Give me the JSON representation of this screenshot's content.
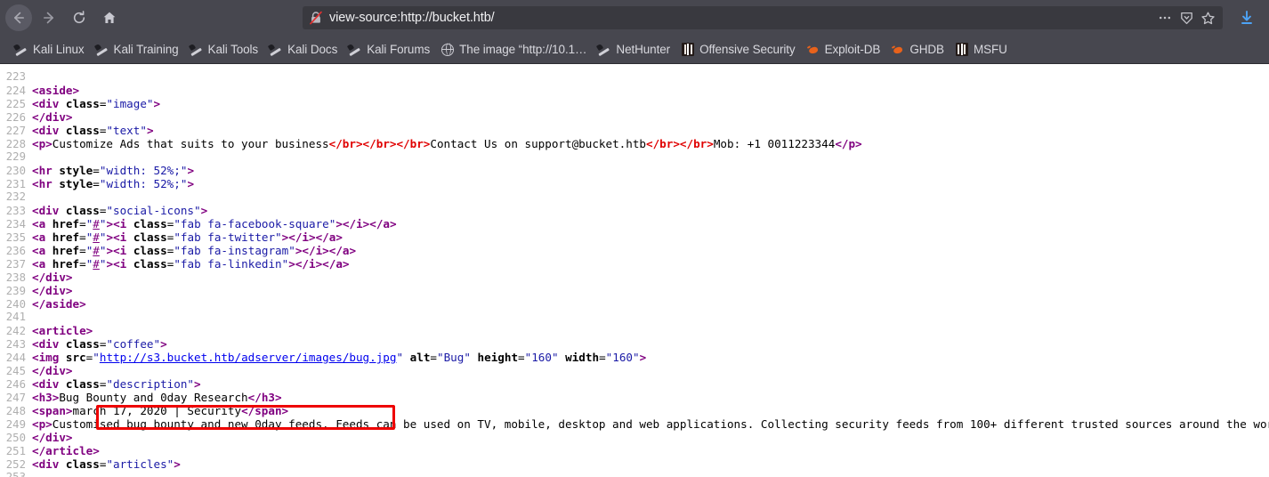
{
  "browser": {
    "nav": {
      "back_label": "Back",
      "forward_label": "Forward",
      "reload_label": "Reload",
      "home_label": "Home"
    },
    "url": "view-source:http://bucket.htb/",
    "url_security_icon": "insecure-padlock-crossed-icon",
    "page_actions_label": "…",
    "reader_label": "Reader view",
    "bookmark_star_label": "Bookmark this page",
    "downloads_label": "Downloads"
  },
  "bookmarks": [
    {
      "label": "Kali Linux",
      "icon": "kali-dragon-icon"
    },
    {
      "label": "Kali Training",
      "icon": "kali-dragon-icon"
    },
    {
      "label": "Kali Tools",
      "icon": "kali-dragon-icon"
    },
    {
      "label": "Kali Docs",
      "icon": "kali-dragon-icon"
    },
    {
      "label": "Kali Forums",
      "icon": "kali-dragon-icon"
    },
    {
      "label": "The image “http://10.1…",
      "icon": "globe-icon"
    },
    {
      "label": "NetHunter",
      "icon": "kali-dragon-icon"
    },
    {
      "label": "Offensive Security",
      "icon": "offensive-security-icon"
    },
    {
      "label": "Exploit-DB",
      "icon": "exploit-db-bug-icon"
    },
    {
      "label": "GHDB",
      "icon": "exploit-db-bug-icon"
    },
    {
      "label": "MSFU",
      "icon": "offensive-security-icon"
    }
  ],
  "source": {
    "first_line": 223,
    "highlight": {
      "color": "#ee0000",
      "target_line": 244,
      "target_text": "http://s3.bucket.htb/adserver/images/bug.jpg"
    },
    "lines": [
      {
        "n": 223,
        "tokens": []
      },
      {
        "n": 224,
        "tokens": [
          {
            "t": "tag",
            "v": "<aside>"
          }
        ]
      },
      {
        "n": 225,
        "tokens": [
          {
            "t": "tag",
            "v": "<div "
          },
          {
            "t": "attn",
            "v": "class"
          },
          {
            "t": "txt",
            "v": "="
          },
          {
            "t": "atv",
            "v": "\"image\""
          },
          {
            "t": "tag",
            "v": ">"
          }
        ]
      },
      {
        "n": 226,
        "tokens": [
          {
            "t": "tag",
            "v": "</div>"
          }
        ]
      },
      {
        "n": 227,
        "tokens": [
          {
            "t": "tag",
            "v": "<div "
          },
          {
            "t": "attn",
            "v": "class"
          },
          {
            "t": "txt",
            "v": "="
          },
          {
            "t": "atv",
            "v": "\"text\""
          },
          {
            "t": "tag",
            "v": ">"
          }
        ]
      },
      {
        "n": 228,
        "tokens": [
          {
            "t": "tag",
            "v": "<p>"
          },
          {
            "t": "txt",
            "v": "Customize Ads that suits to your business"
          },
          {
            "t": "brk",
            "v": "</br></br></br>"
          },
          {
            "t": "txt",
            "v": "Contact Us on support@bucket.htb"
          },
          {
            "t": "brk",
            "v": "</br></br>"
          },
          {
            "t": "txt",
            "v": "Mob: +1 0011223344"
          },
          {
            "t": "tag",
            "v": "</p>"
          }
        ]
      },
      {
        "n": 229,
        "tokens": []
      },
      {
        "n": 230,
        "tokens": [
          {
            "t": "tag",
            "v": "<hr "
          },
          {
            "t": "attn",
            "v": "style"
          },
          {
            "t": "txt",
            "v": "="
          },
          {
            "t": "atv",
            "v": "\"width: 52%;\""
          },
          {
            "t": "tag",
            "v": ">"
          }
        ]
      },
      {
        "n": 231,
        "tokens": [
          {
            "t": "tag",
            "v": "<hr "
          },
          {
            "t": "attn",
            "v": "style"
          },
          {
            "t": "txt",
            "v": "="
          },
          {
            "t": "atv",
            "v": "\"width: 52%;\""
          },
          {
            "t": "tag",
            "v": ">"
          }
        ]
      },
      {
        "n": 232,
        "tokens": []
      },
      {
        "n": 233,
        "tokens": [
          {
            "t": "tag",
            "v": "<div "
          },
          {
            "t": "attn",
            "v": "class"
          },
          {
            "t": "txt",
            "v": "="
          },
          {
            "t": "atv",
            "v": "\"social-icons\""
          },
          {
            "t": "tag",
            "v": ">"
          }
        ]
      },
      {
        "n": 234,
        "tokens": [
          {
            "t": "tag",
            "v": "<a "
          },
          {
            "t": "attn",
            "v": "href"
          },
          {
            "t": "txt",
            "v": "="
          },
          {
            "t": "atv",
            "v": "\""
          },
          {
            "t": "lnkv",
            "v": "#"
          },
          {
            "t": "atv",
            "v": "\""
          },
          {
            "t": "tag",
            "v": ">"
          },
          {
            "t": "tag",
            "v": "<i "
          },
          {
            "t": "attn",
            "v": "class"
          },
          {
            "t": "txt",
            "v": "="
          },
          {
            "t": "atv",
            "v": "\"fab fa-facebook-square\""
          },
          {
            "t": "tag",
            "v": ">"
          },
          {
            "t": "tag",
            "v": "</i>"
          },
          {
            "t": "tag",
            "v": "</a>"
          }
        ]
      },
      {
        "n": 235,
        "tokens": [
          {
            "t": "tag",
            "v": "<a "
          },
          {
            "t": "attn",
            "v": "href"
          },
          {
            "t": "txt",
            "v": "="
          },
          {
            "t": "atv",
            "v": "\""
          },
          {
            "t": "lnkv",
            "v": "#"
          },
          {
            "t": "atv",
            "v": "\""
          },
          {
            "t": "tag",
            "v": ">"
          },
          {
            "t": "tag",
            "v": "<i "
          },
          {
            "t": "attn",
            "v": "class"
          },
          {
            "t": "txt",
            "v": "="
          },
          {
            "t": "atv",
            "v": "\"fab fa-twitter\""
          },
          {
            "t": "tag",
            "v": ">"
          },
          {
            "t": "tag",
            "v": "</i>"
          },
          {
            "t": "tag",
            "v": "</a>"
          }
        ]
      },
      {
        "n": 236,
        "tokens": [
          {
            "t": "tag",
            "v": "<a "
          },
          {
            "t": "attn",
            "v": "href"
          },
          {
            "t": "txt",
            "v": "="
          },
          {
            "t": "atv",
            "v": "\""
          },
          {
            "t": "lnkv",
            "v": "#"
          },
          {
            "t": "atv",
            "v": "\""
          },
          {
            "t": "tag",
            "v": ">"
          },
          {
            "t": "tag",
            "v": "<i "
          },
          {
            "t": "attn",
            "v": "class"
          },
          {
            "t": "txt",
            "v": "="
          },
          {
            "t": "atv",
            "v": "\"fab fa-instagram\""
          },
          {
            "t": "tag",
            "v": ">"
          },
          {
            "t": "tag",
            "v": "</i>"
          },
          {
            "t": "tag",
            "v": "</a>"
          }
        ]
      },
      {
        "n": 237,
        "tokens": [
          {
            "t": "tag",
            "v": "<a "
          },
          {
            "t": "attn",
            "v": "href"
          },
          {
            "t": "txt",
            "v": "="
          },
          {
            "t": "atv",
            "v": "\""
          },
          {
            "t": "lnkv",
            "v": "#"
          },
          {
            "t": "atv",
            "v": "\""
          },
          {
            "t": "tag",
            "v": ">"
          },
          {
            "t": "tag",
            "v": "<i "
          },
          {
            "t": "attn",
            "v": "class"
          },
          {
            "t": "txt",
            "v": "="
          },
          {
            "t": "atv",
            "v": "\"fab fa-linkedin\""
          },
          {
            "t": "tag",
            "v": ">"
          },
          {
            "t": "tag",
            "v": "</i>"
          },
          {
            "t": "tag",
            "v": "</a>"
          }
        ]
      },
      {
        "n": 238,
        "tokens": [
          {
            "t": "tag",
            "v": "</div>"
          }
        ]
      },
      {
        "n": 239,
        "tokens": [
          {
            "t": "tag",
            "v": "</div>"
          }
        ]
      },
      {
        "n": 240,
        "tokens": [
          {
            "t": "tag",
            "v": "</aside>"
          }
        ]
      },
      {
        "n": 241,
        "tokens": []
      },
      {
        "n": 242,
        "tokens": [
          {
            "t": "tag",
            "v": "<article>"
          }
        ]
      },
      {
        "n": 243,
        "tokens": [
          {
            "t": "tag",
            "v": "<div "
          },
          {
            "t": "attn",
            "v": "class"
          },
          {
            "t": "txt",
            "v": "="
          },
          {
            "t": "atv",
            "v": "\"coffee\""
          },
          {
            "t": "tag",
            "v": ">"
          }
        ]
      },
      {
        "n": 244,
        "tokens": [
          {
            "t": "tag",
            "v": "<img "
          },
          {
            "t": "attn",
            "v": "src"
          },
          {
            "t": "txt",
            "v": "="
          },
          {
            "t": "atv",
            "v": "\""
          },
          {
            "t": "lnk",
            "v": "http://s3.bucket.htb/adserver/images/bug.jpg"
          },
          {
            "t": "atv",
            "v": "\""
          },
          {
            "t": "txt",
            "v": " "
          },
          {
            "t": "attn",
            "v": "alt"
          },
          {
            "t": "txt",
            "v": "="
          },
          {
            "t": "atv",
            "v": "\"Bug\""
          },
          {
            "t": "txt",
            "v": " "
          },
          {
            "t": "attn",
            "v": "height"
          },
          {
            "t": "txt",
            "v": "="
          },
          {
            "t": "atv",
            "v": "\"160\""
          },
          {
            "t": "txt",
            "v": " "
          },
          {
            "t": "attn",
            "v": "width"
          },
          {
            "t": "txt",
            "v": "="
          },
          {
            "t": "atv",
            "v": "\"160\""
          },
          {
            "t": "tag",
            "v": ">"
          }
        ]
      },
      {
        "n": 245,
        "tokens": [
          {
            "t": "tag",
            "v": "</div>"
          }
        ]
      },
      {
        "n": 246,
        "tokens": [
          {
            "t": "tag",
            "v": "<div "
          },
          {
            "t": "attn",
            "v": "class"
          },
          {
            "t": "txt",
            "v": "="
          },
          {
            "t": "atv",
            "v": "\"description\""
          },
          {
            "t": "tag",
            "v": ">"
          }
        ]
      },
      {
        "n": 247,
        "tokens": [
          {
            "t": "tag",
            "v": "<h3>"
          },
          {
            "t": "txt",
            "v": "Bug Bounty and 0day Research"
          },
          {
            "t": "tag",
            "v": "</h3>"
          }
        ]
      },
      {
        "n": 248,
        "tokens": [
          {
            "t": "tag",
            "v": "<span>"
          },
          {
            "t": "txt",
            "v": "march 17, 2020 | Security"
          },
          {
            "t": "tag",
            "v": "</span>"
          }
        ]
      },
      {
        "n": 249,
        "tokens": [
          {
            "t": "tag",
            "v": "<p>"
          },
          {
            "t": "txt",
            "v": "Customised bug bounty and new 0day feeds. Feeds can be used on TV, mobile, desktop and web applications. Collecting security feeds from 100+ different trusted sources around the world."
          },
          {
            "t": "tag",
            "v": "</p>"
          }
        ]
      },
      {
        "n": 250,
        "tokens": [
          {
            "t": "tag",
            "v": "</div>"
          }
        ]
      },
      {
        "n": 251,
        "tokens": [
          {
            "t": "tag",
            "v": "</article>"
          }
        ]
      },
      {
        "n": 252,
        "tokens": [
          {
            "t": "tag",
            "v": "<div "
          },
          {
            "t": "attn",
            "v": "class"
          },
          {
            "t": "txt",
            "v": "="
          },
          {
            "t": "atv",
            "v": "\"articles\""
          },
          {
            "t": "tag",
            "v": ">"
          }
        ]
      },
      {
        "n": 253,
        "tokens": []
      }
    ]
  }
}
